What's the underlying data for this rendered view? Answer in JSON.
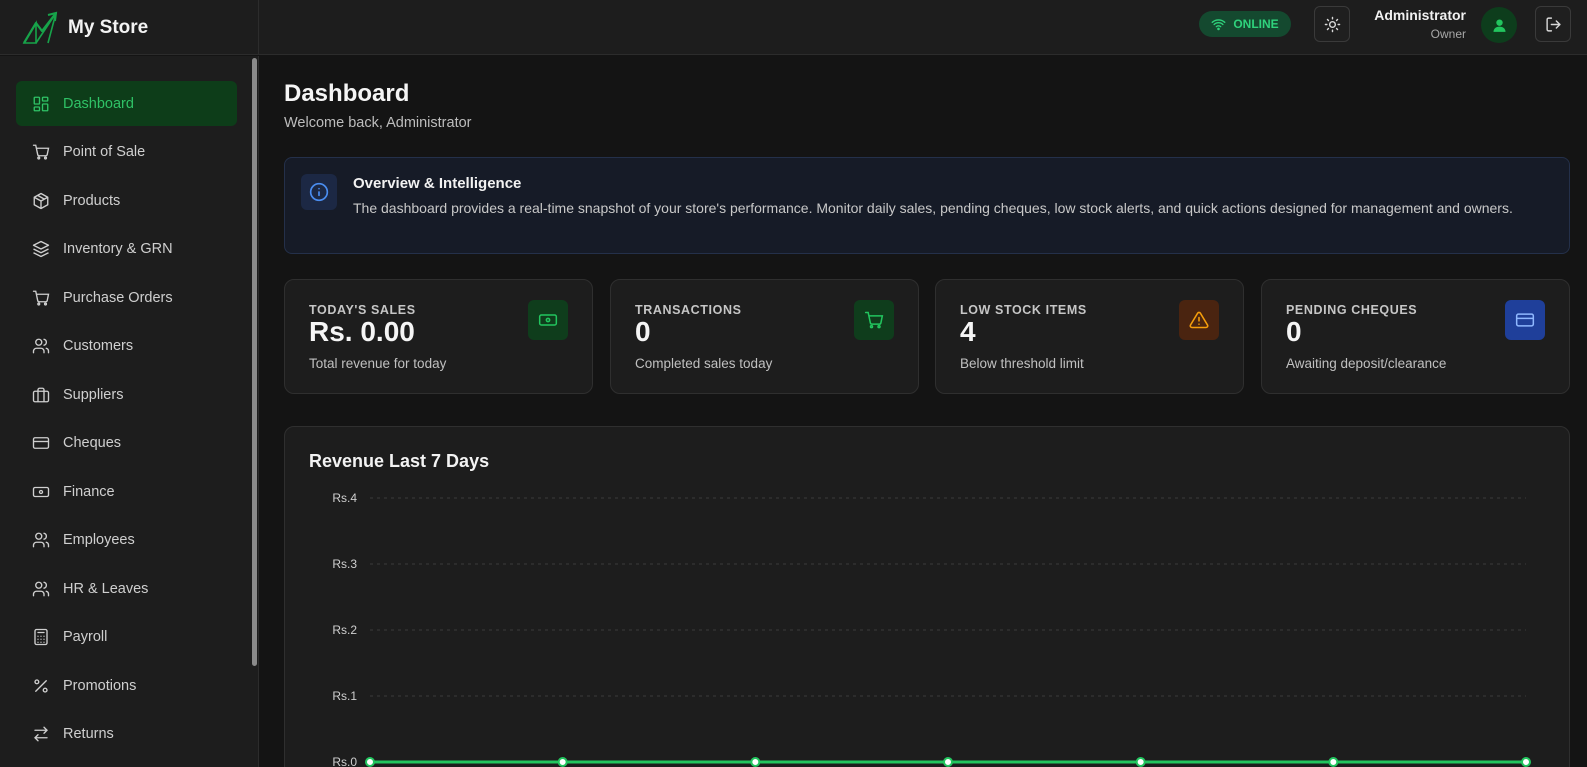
{
  "brand": {
    "name": "My Store",
    "accent": "#22c55e"
  },
  "header": {
    "status": "ONLINE",
    "user_name": "Administrator",
    "user_role": "Owner"
  },
  "sidebar": {
    "items": [
      {
        "label": "Dashboard",
        "icon": "layout-grid-icon",
        "active": true
      },
      {
        "label": "Point of Sale",
        "icon": "cart-icon"
      },
      {
        "label": "Products",
        "icon": "package-icon"
      },
      {
        "label": "Inventory & GRN",
        "icon": "layers-icon"
      },
      {
        "label": "Purchase Orders",
        "icon": "cart-icon"
      },
      {
        "label": "Customers",
        "icon": "users-icon"
      },
      {
        "label": "Suppliers",
        "icon": "briefcase-icon"
      },
      {
        "label": "Cheques",
        "icon": "credit-card-icon"
      },
      {
        "label": "Finance",
        "icon": "banknote-icon"
      },
      {
        "label": "Employees",
        "icon": "users-icon"
      },
      {
        "label": "HR & Leaves",
        "icon": "users-icon"
      },
      {
        "label": "Payroll",
        "icon": "calculator-icon"
      },
      {
        "label": "Promotions",
        "icon": "percent-icon"
      },
      {
        "label": "Returns",
        "icon": "arrows-swap-icon"
      }
    ]
  },
  "page": {
    "title": "Dashboard",
    "subtitle": "Welcome back, Administrator"
  },
  "info": {
    "title": "Overview & Intelligence",
    "text": "The dashboard provides a real-time snapshot of your store's performance. Monitor daily sales, pending cheques, low stock alerts, and quick actions designed for management and owners."
  },
  "stats": [
    {
      "label": "TODAY'S SALES",
      "value": "Rs. 0.00",
      "desc": "Total revenue for today",
      "icon": "banknote-icon",
      "color": "#22c55e"
    },
    {
      "label": "TRANSACTIONS",
      "value": "0",
      "desc": "Completed sales today",
      "icon": "cart-icon",
      "color": "#22c55e"
    },
    {
      "label": "LOW STOCK ITEMS",
      "value": "4",
      "desc": "Below threshold limit",
      "icon": "alert-triangle-icon",
      "color": "#f59e0b"
    },
    {
      "label": "PENDING CHEQUES",
      "value": "0",
      "desc": "Awaiting deposit/clearance",
      "icon": "credit-card-icon",
      "color": "#3b82f6"
    }
  ],
  "chart_data": {
    "type": "line",
    "title": "Revenue Last 7 Days",
    "y_ticks": [
      "Rs.0",
      "Rs.1",
      "Rs.2",
      "Rs.3",
      "Rs.4"
    ],
    "ylim": [
      0,
      4
    ],
    "values": [
      0,
      0,
      0,
      0,
      0,
      0,
      0
    ],
    "grid": true,
    "color": "#22c55e"
  }
}
